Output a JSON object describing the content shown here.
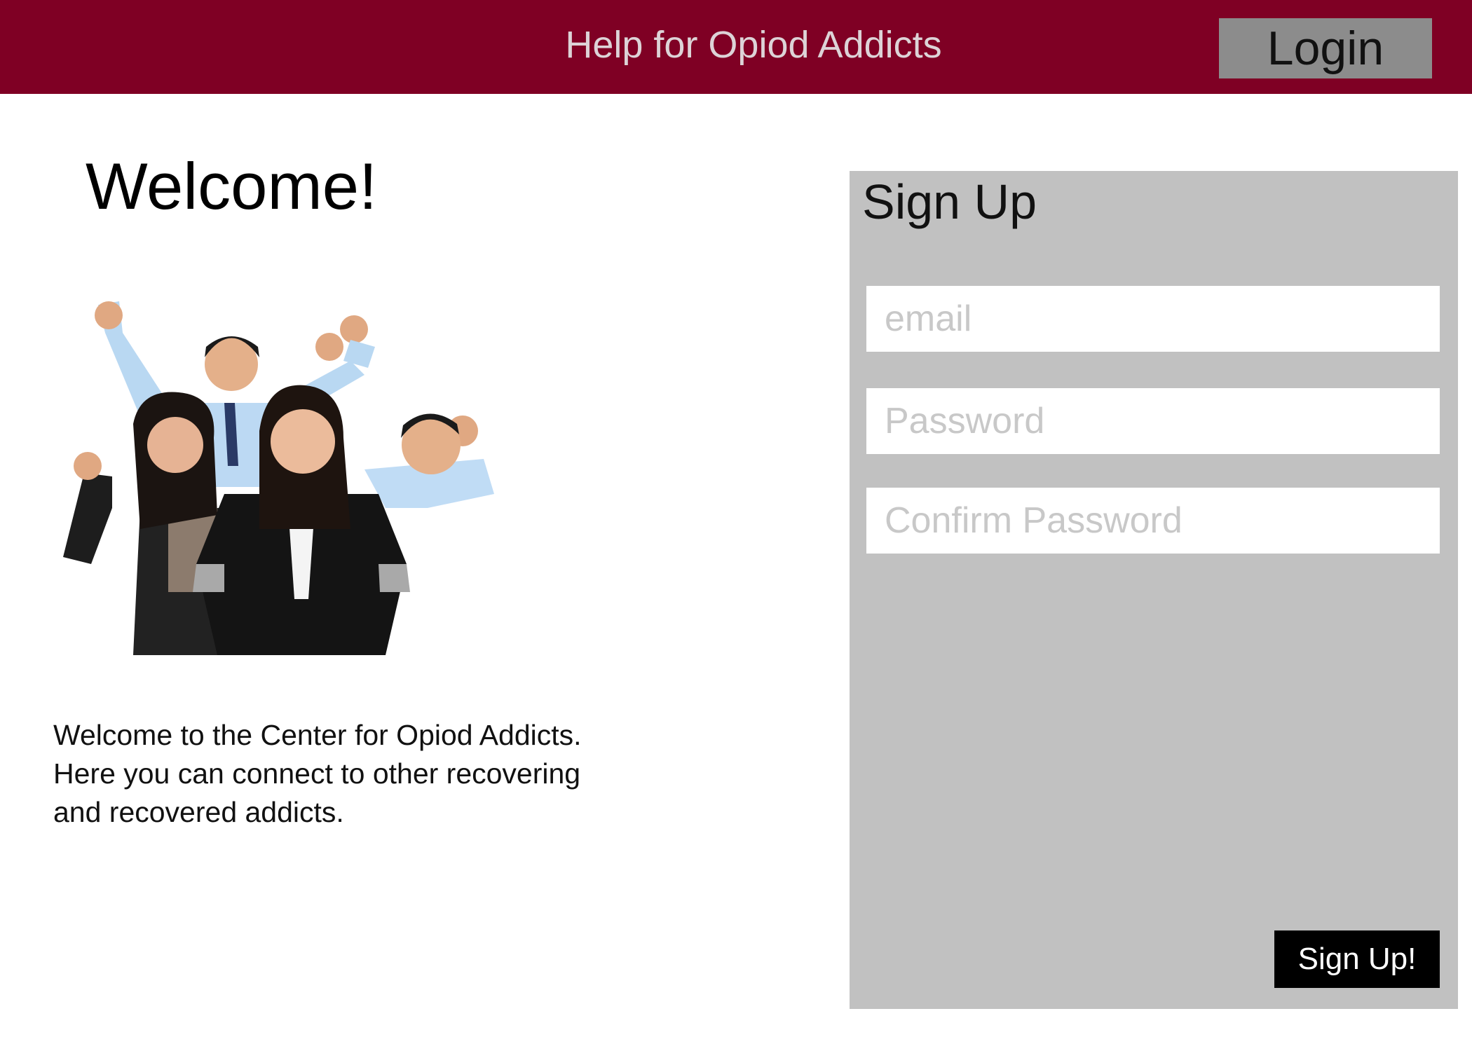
{
  "header": {
    "title": "Help for Opiod Addicts",
    "login_label": "Login",
    "background_color": "#7f0024"
  },
  "main": {
    "welcome_heading": "Welcome!",
    "image_subject": "group of five cheering business people",
    "intro_text": "   Welcome to the Center for Opiod Addicts.\nHere you can connect to other recovering\nand recovered addicts."
  },
  "signup": {
    "title": "Sign Up",
    "email_placeholder": "email",
    "password_placeholder": "Password",
    "confirm_password_placeholder": "Confirm Password",
    "submit_label": "Sign Up!",
    "panel_color": "#c1c1c1"
  }
}
